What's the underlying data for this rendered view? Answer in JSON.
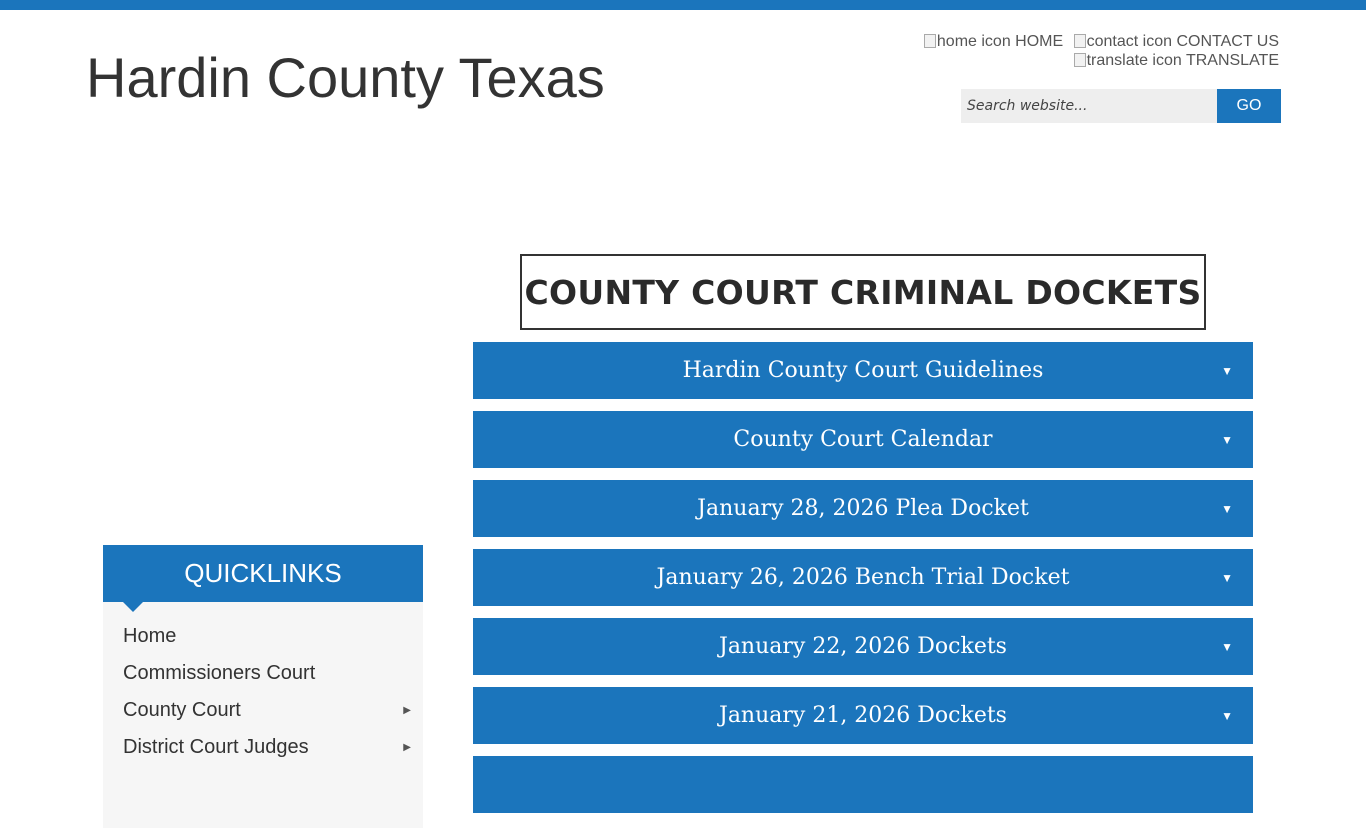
{
  "site": {
    "title": "Hardin County Texas"
  },
  "utility_nav": {
    "home": {
      "icon_alt": "home icon",
      "label": "HOME",
      "icon": "home-icon"
    },
    "contact": {
      "icon_alt": "contact icon",
      "label": "CONTACT US",
      "icon": "contact-icon"
    },
    "translate": {
      "icon_alt": "translate icon",
      "label": "TRANSLATE",
      "icon": "translate-icon"
    }
  },
  "search": {
    "placeholder": "Search website...",
    "button_label": "GO"
  },
  "page": {
    "heading": "COUNTY COURT CRIMINAL DOCKETS"
  },
  "accordion": {
    "arrow_glyph": "▼",
    "items": [
      {
        "label": "Hardin County Court Guidelines"
      },
      {
        "label": "County Court Calendar"
      },
      {
        "label": "January 28, 2026 Plea Docket"
      },
      {
        "label": "January 26, 2026 Bench Trial Docket"
      },
      {
        "label": "January 22, 2026 Dockets"
      },
      {
        "label": "January 21, 2026 Dockets"
      },
      {
        "label": ""
      }
    ]
  },
  "quicklinks": {
    "title": "QUICKLINKS",
    "caret_glyph": "▶",
    "items": [
      {
        "label": "Home",
        "has_submenu": false
      },
      {
        "label": "Commissioners Court",
        "has_submenu": false
      },
      {
        "label": "County Court",
        "has_submenu": true
      },
      {
        "label": "District Court Judges",
        "has_submenu": true
      }
    ]
  },
  "colors": {
    "brand_blue": "#1b75bc",
    "text_dark": "#333333",
    "sidebar_bg": "#f6f6f6"
  }
}
